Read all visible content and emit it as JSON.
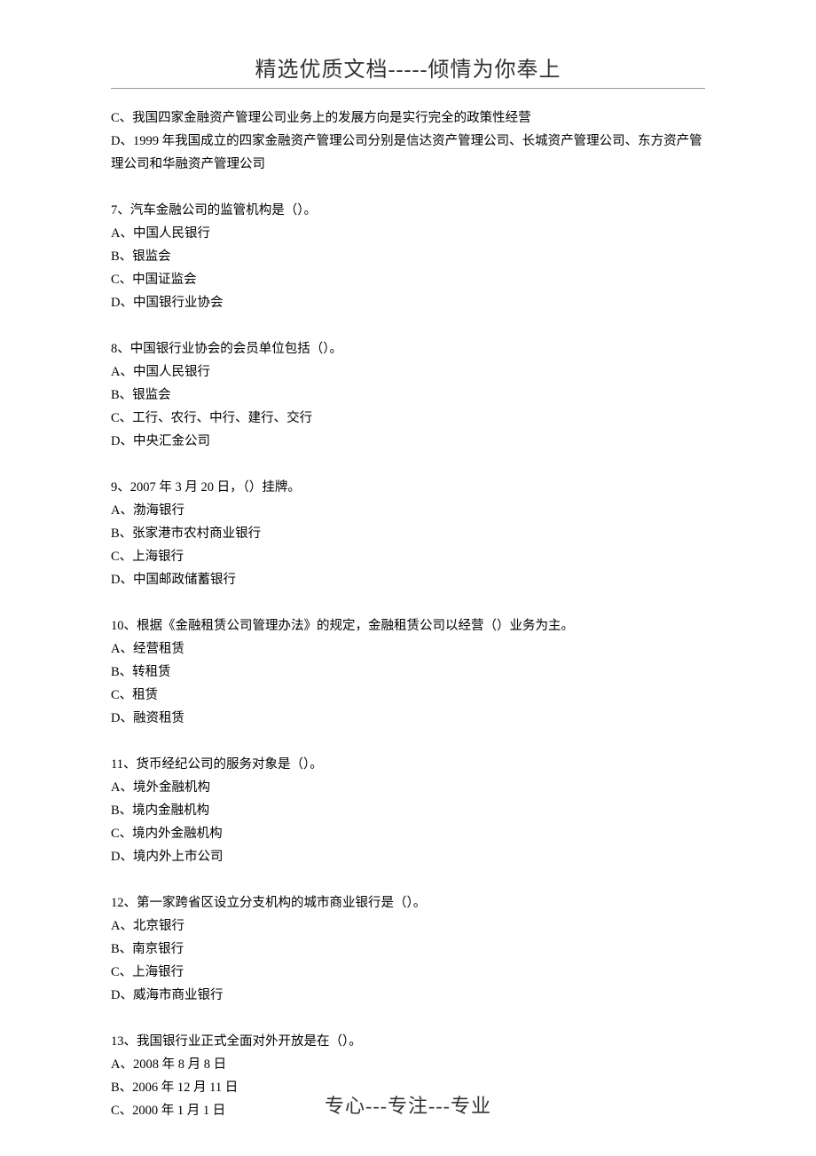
{
  "header": "精选优质文档-----倾情为你奉上",
  "footer": "专心---专注---专业",
  "orphan_lines": [
    "C、我国四家金融资产管理公司业务上的发展方向是实行完全的政策性经营",
    "D、1999 年我国成立的四家金融资产管理公司分别是信达资产管理公司、长城资产管理公司、东方资产管理公司和华融资产管理公司"
  ],
  "questions": [
    {
      "stem": "7、汽车金融公司的监管机构是（）。",
      "options": [
        "A、中国人民银行",
        "B、银监会",
        "C、中国证监会",
        "D、中国银行业协会"
      ]
    },
    {
      "stem": "8、中国银行业协会的会员单位包括（）。",
      "options": [
        "A、中国人民银行",
        "B、银监会",
        "C、工行、农行、中行、建行、交行",
        "D、中央汇金公司"
      ]
    },
    {
      "stem": "9、2007 年 3 月 20 日，（）挂牌。",
      "options": [
        "A、渤海银行",
        "B、张家港市农村商业银行",
        "C、上海银行",
        "D、中国邮政储蓄银行"
      ]
    },
    {
      "stem": "10、根据《金融租赁公司管理办法》的规定，金融租赁公司以经营（）业务为主。",
      "options": [
        "A、经营租赁",
        "B、转租赁",
        "C、租赁",
        "D、融资租赁"
      ]
    },
    {
      "stem": "11、货币经纪公司的服务对象是（）。",
      "options": [
        "A、境外金融机构",
        "B、境内金融机构",
        "C、境内外金融机构",
        "D、境内外上市公司"
      ]
    },
    {
      "stem": "12、第一家跨省区设立分支机构的城市商业银行是（）。",
      "options": [
        "A、北京银行",
        "B、南京银行",
        "C、上海银行",
        "D、威海市商业银行"
      ]
    },
    {
      "stem": "13、我国银行业正式全面对外开放是在（）。",
      "options": [
        "A、2008 年 8 月 8 日",
        "B、2006 年 12 月 11 日",
        "C、2000 年 1 月 1 日"
      ]
    }
  ]
}
